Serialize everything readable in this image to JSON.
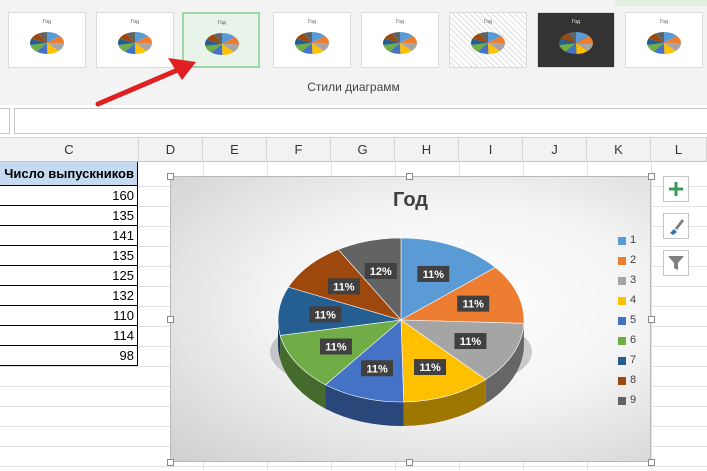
{
  "ribbon": {
    "group_label": "Стили диаграмм",
    "style_thumbnails": [
      {
        "label": "Год",
        "selected": false
      },
      {
        "label": "Год",
        "selected": false
      },
      {
        "label": "Год",
        "selected": true
      },
      {
        "label": "Год",
        "selected": false
      },
      {
        "label": "Год",
        "selected": false
      },
      {
        "label": "Год",
        "selected": false
      },
      {
        "label": "Год",
        "selected": false
      },
      {
        "label": "Год",
        "selected": false
      }
    ]
  },
  "columns": [
    "C",
    "D",
    "E",
    "F",
    "G",
    "H",
    "I",
    "J",
    "K",
    "L"
  ],
  "sheet": {
    "header": "Число выпускников",
    "values": [
      "160",
      "135",
      "141",
      "135",
      "125",
      "132",
      "110",
      "114",
      "98"
    ]
  },
  "chart_data": {
    "type": "pie",
    "title": "Год",
    "categories": [
      "1",
      "2",
      "3",
      "4",
      "5",
      "6",
      "7",
      "8",
      "9"
    ],
    "values": [
      160,
      135,
      141,
      135,
      125,
      132,
      110,
      114,
      98
    ],
    "data_labels": [
      "11%",
      "11%",
      "11%",
      "11%",
      "11%",
      "11%",
      "11%",
      "11%",
      "12%"
    ],
    "colors": [
      "#5b9bd5",
      "#ed7d31",
      "#a5a5a5",
      "#ffc000",
      "#4472c4",
      "#70ad47",
      "#255e91",
      "#9e480e",
      "#636363"
    ],
    "legend_position": "right",
    "style": "3d"
  },
  "chart_tools": [
    "plus-icon",
    "brush-icon",
    "filter-icon"
  ],
  "annotation": {
    "color": "#e02020"
  }
}
